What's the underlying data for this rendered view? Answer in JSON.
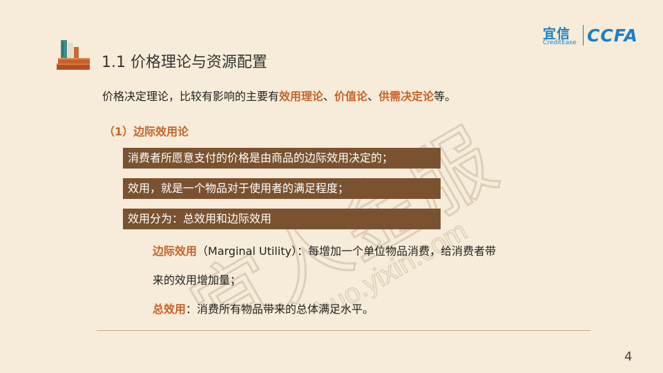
{
  "header": {
    "title": "1.1 价格理论与资源配置"
  },
  "logo": {
    "brand_cn": "宜信",
    "brand_en": "CreditEase",
    "partner": "CCFA"
  },
  "watermark": {
    "text_cn": "宜人金服",
    "text_url": "xinghuo.yixin.com"
  },
  "intro": {
    "prefix": "价格决定理论，比较有影响的主要有",
    "term1": "效用理论",
    "sep1": "、",
    "term2": "价值论",
    "sep2": "、",
    "term3": "供需决定论",
    "suffix": "等。"
  },
  "section": {
    "heading": "（1）边际效用论",
    "bars": [
      "消费者所愿意支付的价格是由商品的边际效用决定的；",
      "效用，就是一个物品对于使用者的满足程度；",
      "效用分为：总效用和边际效用"
    ],
    "marginal": {
      "term": "边际效用",
      "line1": "（Marginal Utility）：每增加一个单位物品消费，给消费者带",
      "line2": "来的效用增加量；"
    },
    "total": {
      "term": "总效用",
      "text": "：消费所有物品带来的总体满足水平。"
    }
  },
  "footer": {
    "page_number": "4"
  },
  "colors": {
    "background": "#f7ecd9",
    "accent": "#c8622a",
    "bar": "#7a5230",
    "logo": "#1a7fc7"
  }
}
